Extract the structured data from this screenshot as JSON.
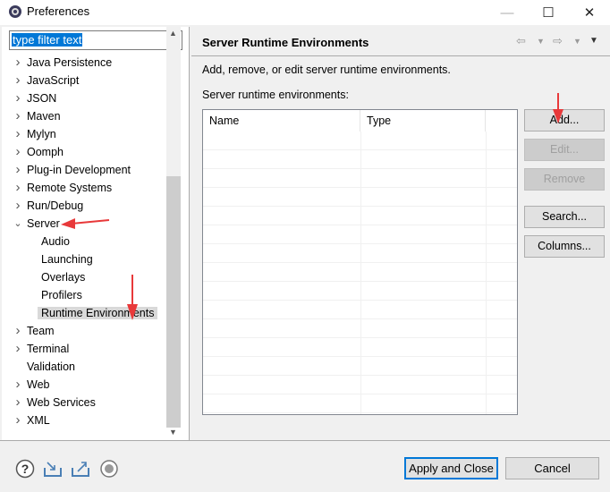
{
  "window": {
    "title": "Preferences",
    "minimize": "—",
    "maximize": "☐",
    "close": "✕"
  },
  "filter": {
    "value": "type filter text"
  },
  "tree": [
    {
      "label": "Java Persistence",
      "expanded": false,
      "child": false
    },
    {
      "label": "JavaScript",
      "expanded": false,
      "child": false
    },
    {
      "label": "JSON",
      "expanded": false,
      "child": false
    },
    {
      "label": "Maven",
      "expanded": false,
      "child": false
    },
    {
      "label": "Mylyn",
      "expanded": false,
      "child": false
    },
    {
      "label": "Oomph",
      "expanded": false,
      "child": false
    },
    {
      "label": "Plug-in Development",
      "expanded": false,
      "child": false
    },
    {
      "label": "Remote Systems",
      "expanded": false,
      "child": false
    },
    {
      "label": "Run/Debug",
      "expanded": false,
      "child": false
    },
    {
      "label": "Server",
      "expanded": true,
      "child": false
    },
    {
      "label": "Audio",
      "child": true
    },
    {
      "label": "Launching",
      "child": true
    },
    {
      "label": "Overlays",
      "child": true
    },
    {
      "label": "Profilers",
      "child": true
    },
    {
      "label": "Runtime Environments",
      "child": true,
      "selected": true
    },
    {
      "label": "Team",
      "expanded": false,
      "child": false
    },
    {
      "label": "Terminal",
      "expanded": false,
      "child": false
    },
    {
      "label": "Validation",
      "leaf": true,
      "child": false
    },
    {
      "label": "Web",
      "expanded": false,
      "child": false
    },
    {
      "label": "Web Services",
      "expanded": false,
      "child": false
    },
    {
      "label": "XML",
      "expanded": false,
      "child": false
    }
  ],
  "page": {
    "title": "Server Runtime Environments",
    "description": "Add, remove, or edit server runtime environments.",
    "list_label": "Server runtime environments:"
  },
  "table": {
    "columns": [
      "Name",
      "Type"
    ]
  },
  "buttons": {
    "add": "Add...",
    "edit": "Edit...",
    "remove": "Remove",
    "search": "Search...",
    "columns": "Columns..."
  },
  "footer": {
    "apply": "Apply and Close",
    "cancel": "Cancel"
  },
  "colors": {
    "accent": "#0078d7",
    "arrow": "#e8393a"
  }
}
